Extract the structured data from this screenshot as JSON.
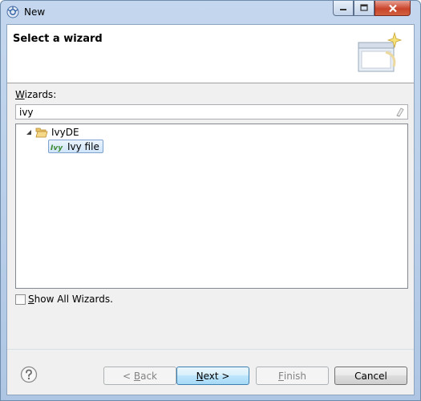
{
  "window": {
    "title": "New"
  },
  "banner": {
    "title": "Select a wizard"
  },
  "wizards": {
    "label": "Wizards:",
    "mnemonic": "W",
    "label_rest": "izards:",
    "filter_value": "ivy"
  },
  "tree": {
    "category": "IvyDE",
    "selected_item": "Ivy file",
    "ivy_icon_text": "Ivy"
  },
  "show_all": {
    "label": "Show All Wizards.",
    "mnemonic": "S",
    "label_rest": "how All Wizards.",
    "checked": false
  },
  "buttons": {
    "back": {
      "prefix": "< ",
      "mnemonic": "B",
      "rest": "ack",
      "enabled": false
    },
    "next": {
      "mnemonic": "N",
      "rest": "ext >",
      "enabled": true
    },
    "finish": {
      "mnemonic": "F",
      "rest": "inish",
      "enabled": false
    },
    "cancel": {
      "label": "Cancel",
      "enabled": true
    }
  },
  "icons": {
    "app": "eclipse-app-icon",
    "minimize": "minimize-icon",
    "maximize": "maximize-icon",
    "close": "close-icon",
    "banner": "new-wizard-banner-icon",
    "clear": "clear-filter-icon",
    "expander": "tree-expanded-icon",
    "folder": "open-folder-icon",
    "ivy": "ivy-file-icon",
    "help": "help-icon"
  },
  "colors": {
    "selection_border": "#7da2ce",
    "default_button_border": "#3c7fb1",
    "close_button": "#c9452b"
  }
}
